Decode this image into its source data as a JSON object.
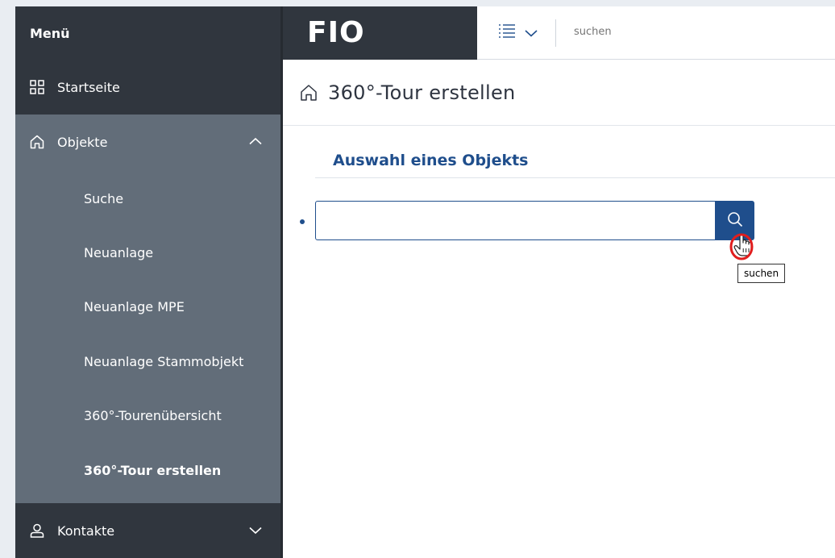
{
  "sidebar": {
    "menu_title": "Menü",
    "startseite": "Startseite",
    "objekte": "Objekte",
    "objekte_items": [
      {
        "label": "Suche"
      },
      {
        "label": "Neuanlage"
      },
      {
        "label": "Neuanlage MPE"
      },
      {
        "label": "Neuanlage Stammobjekt"
      },
      {
        "label": "360°-Tourenübersicht"
      },
      {
        "label": "360°-Tour erstellen"
      }
    ],
    "kontakte": "Kontakte"
  },
  "header": {
    "logo": "FIO",
    "search_placeholder": "suchen"
  },
  "main": {
    "page_title": "360°-Tour erstellen",
    "section_title": "Auswahl eines Objekts",
    "object_input_value": "",
    "tooltip": "suchen"
  },
  "colors": {
    "sidebar_dark": "#30363e",
    "sidebar_mid": "#626d79",
    "accent": "#1f4e8c",
    "cursor_highlight": "#e11d1d"
  },
  "icons": [
    "grid-icon",
    "home-icon",
    "chevron-up-icon",
    "user-icon",
    "chevron-down-icon",
    "list-icon",
    "search-icon",
    "hand-cursor-icon"
  ]
}
